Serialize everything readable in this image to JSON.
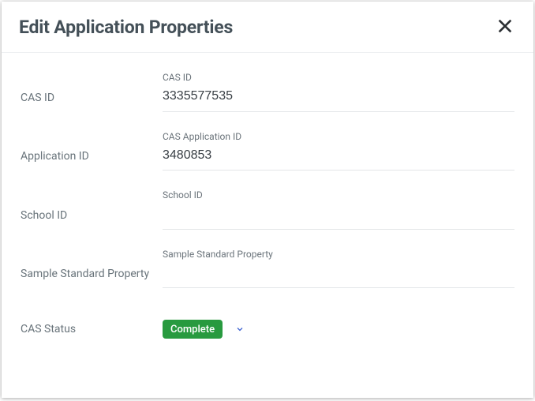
{
  "dialog": {
    "title": "Edit Application Properties"
  },
  "fields": {
    "cas_id": {
      "row_label": "CAS ID",
      "floating_label": "CAS ID",
      "value": "3335577535"
    },
    "application_id": {
      "row_label": "Application ID",
      "floating_label": "CAS Application ID",
      "value": "3480853"
    },
    "school_id": {
      "row_label": "School ID",
      "floating_label": "School ID",
      "value": ""
    },
    "sample_standard": {
      "row_label": "Sample Standard Property",
      "floating_label": "Sample Standard Property",
      "value": ""
    },
    "cas_status": {
      "row_label": "CAS Status",
      "selected_label": "Complete",
      "selected_color": "#289a3f"
    }
  }
}
